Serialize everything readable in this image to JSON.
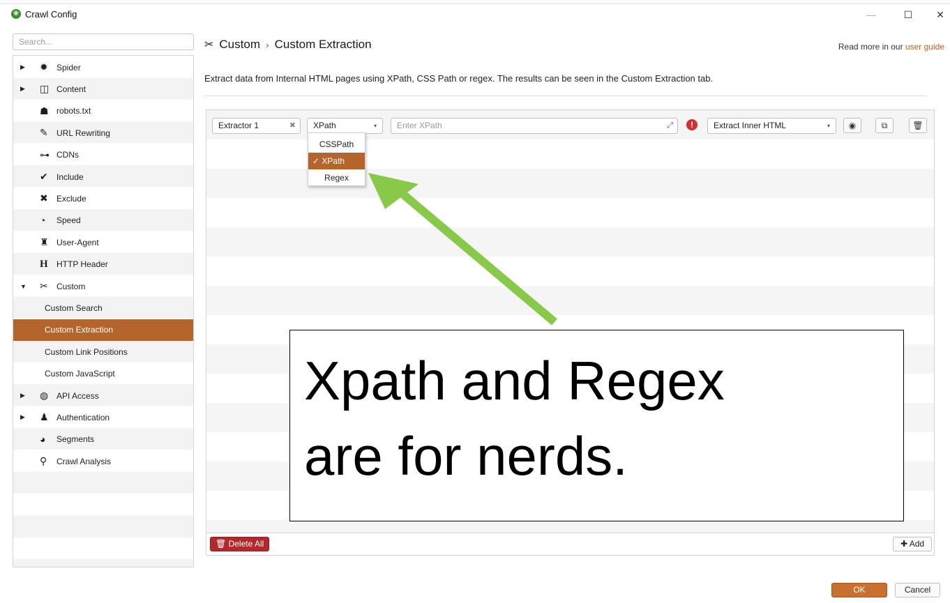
{
  "window": {
    "title": "Crawl Config",
    "controls": {
      "minimize": "—",
      "maximize": "☐",
      "close": "✕"
    }
  },
  "sidebar": {
    "search_placeholder": "Search...",
    "items": [
      {
        "label": "Spider",
        "icon": "gear-icon",
        "glyph": "✹",
        "caret": "▶",
        "child": false,
        "selected": false
      },
      {
        "label": "Content",
        "icon": "columns-icon",
        "glyph": "◫",
        "caret": "▶",
        "child": false,
        "selected": false
      },
      {
        "label": "robots.txt",
        "icon": "robot-icon",
        "glyph": "☗",
        "caret": "",
        "child": false,
        "selected": false
      },
      {
        "label": "URL Rewriting",
        "icon": "edit-icon",
        "glyph": "✎",
        "caret": "",
        "child": false,
        "selected": false
      },
      {
        "label": "CDNs",
        "icon": "sitemap-icon",
        "glyph": "⊶",
        "caret": "",
        "child": false,
        "selected": false
      },
      {
        "label": "Include",
        "icon": "check-circle-icon",
        "glyph": "✔",
        "caret": "",
        "child": false,
        "selected": false
      },
      {
        "label": "Exclude",
        "icon": "times-circle-icon",
        "glyph": "✖",
        "caret": "",
        "child": false,
        "selected": false
      },
      {
        "label": "Speed",
        "icon": "tachometer-icon",
        "glyph": "◔",
        "caret": "",
        "child": false,
        "selected": false
      },
      {
        "label": "User-Agent",
        "icon": "user-secret-icon",
        "glyph": "♜",
        "caret": "",
        "child": false,
        "selected": false
      },
      {
        "label": "HTTP Header",
        "icon": "header-icon",
        "glyph": "H",
        "caret": "",
        "child": false,
        "selected": false
      },
      {
        "label": "Custom",
        "icon": "tools-icon",
        "glyph": "✂",
        "caret": "▼",
        "child": false,
        "selected": false
      },
      {
        "label": "Custom Search",
        "icon": "",
        "glyph": "",
        "caret": "",
        "child": true,
        "selected": false
      },
      {
        "label": "Custom Extraction",
        "icon": "",
        "glyph": "",
        "caret": "",
        "child": true,
        "selected": true
      },
      {
        "label": "Custom Link Positions",
        "icon": "",
        "glyph": "",
        "caret": "",
        "child": true,
        "selected": false
      },
      {
        "label": "Custom JavaScript",
        "icon": "",
        "glyph": "",
        "caret": "",
        "child": true,
        "selected": false
      },
      {
        "label": "API Access",
        "icon": "globe-icon",
        "glyph": "◍",
        "caret": "▶",
        "child": false,
        "selected": false
      },
      {
        "label": "Authentication",
        "icon": "user-lock-icon",
        "glyph": "♟",
        "caret": "▶",
        "child": false,
        "selected": false
      },
      {
        "label": "Segments",
        "icon": "pie-chart-icon",
        "glyph": "◕",
        "caret": "",
        "child": false,
        "selected": false
      },
      {
        "label": "Crawl Analysis",
        "icon": "search-icon",
        "glyph": "⚲",
        "caret": "",
        "child": false,
        "selected": false
      }
    ]
  },
  "header": {
    "crumb_root": "Custom",
    "crumb_sep": "›",
    "crumb_page": "Custom Extraction",
    "read_more_prefix": "Read more in our",
    "read_more_link": "user guide",
    "description": "Extract data from Internal HTML pages using XPath, CSS Path or regex. The results can be seen in the Custom Extraction tab."
  },
  "extractor": {
    "name": "Extractor 1",
    "clear_glyph": "✖",
    "type_selected": "XPath",
    "type_options": [
      "CSSPath",
      "XPath",
      "Regex"
    ],
    "type_checkmark": "✓",
    "expression_placeholder": "Enter XPath",
    "expand_glyph": "⤢",
    "error_glyph": "!",
    "extract_mode": "Extract Inner HTML",
    "dropdown_arrow": "▾",
    "action_icons": [
      {
        "name": "test-globe-icon",
        "glyph": "◉"
      },
      {
        "name": "duplicate-icon",
        "glyph": "⧉"
      },
      {
        "name": "trash-icon",
        "glyph": "🗑"
      }
    ]
  },
  "footer": {
    "delete_all_label": "Delete All",
    "delete_all_icon": "🗑",
    "add_label": "Add",
    "add_icon": "✚",
    "ok_label": "OK",
    "cancel_label": "Cancel"
  },
  "annotation": {
    "callout_text": "Xpath and Regex\nare for nerds.",
    "arrow_color": "#88c94a"
  },
  "colors": {
    "accent": "#b5652c",
    "danger": "#b3282a",
    "error_icon": "#d32f2f",
    "link": "#c55e1e"
  }
}
